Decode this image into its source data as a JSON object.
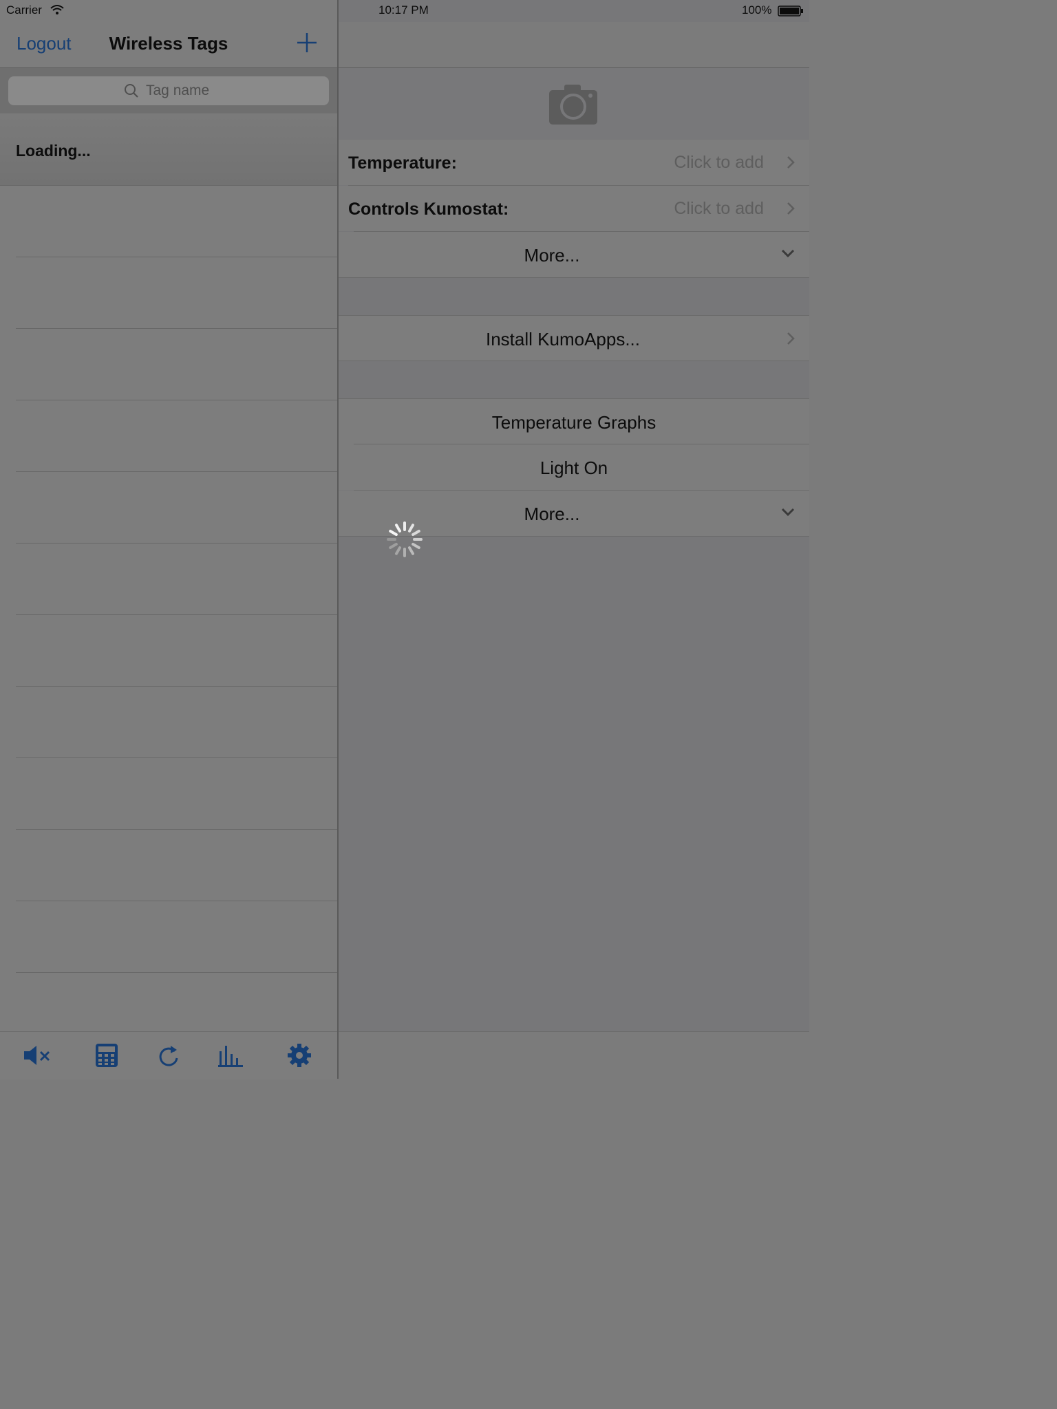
{
  "status_bar": {
    "carrier": "Carrier",
    "time": "10:17 PM",
    "battery": "100%"
  },
  "left_nav": {
    "logout": "Logout",
    "title": "Wireless Tags",
    "add_icon": "plus-icon"
  },
  "search": {
    "placeholder": "Tag name",
    "icon": "search-icon"
  },
  "tag_list": {
    "loading": "Loading..."
  },
  "toolbar": {
    "icons": [
      "mute-icon",
      "calculator-icon",
      "refresh-icon",
      "bar-chart-icon",
      "gear-icon"
    ]
  },
  "detail": {
    "camera_icon": "camera-icon",
    "temperature_label": "Temperature:",
    "temperature_value": "Click to add",
    "kumostat_label": "Controls Kumostat:",
    "kumostat_value": "Click to add",
    "more_1": "More...",
    "install_kumoapps": "Install KumoApps...",
    "temperature_graphs": "Temperature Graphs",
    "light_on": "Light On",
    "more_2": "More..."
  },
  "colors": {
    "accent": "#163f74",
    "overlay_bg": "#7b7b7b"
  }
}
